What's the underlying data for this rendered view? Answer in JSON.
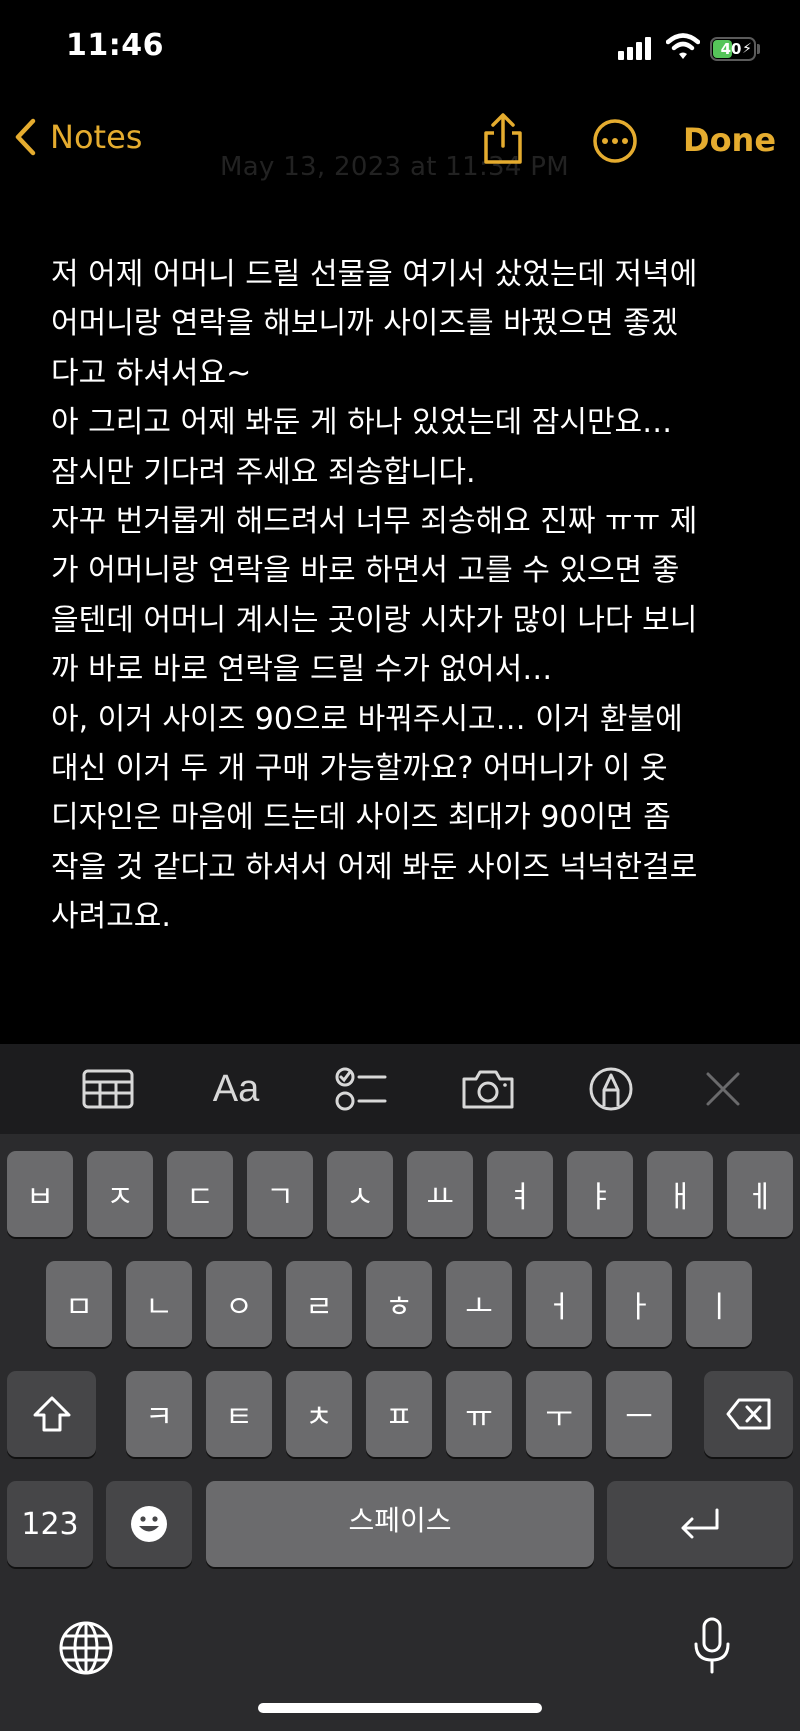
{
  "status": {
    "time": "11:46",
    "battery": "40"
  },
  "nav": {
    "back_label": "Notes",
    "done_label": "Done",
    "date_hint": "May 13, 2023 at 11:34 PM"
  },
  "note": {
    "lines": [
      "저 어제 어머니 드릴 선물을 여기서 샀었는데 저녁에",
      "어머니랑 연락을 해보니까 사이즈를 바꿨으면 좋겠",
      "다고 하셔서요~",
      "아 그리고 어제 봐둔 게 하나 있었는데 잠시만요…",
      "잠시만 기다려 주세요 죄송합니다.",
      "자꾸 번거롭게 해드려서 너무 죄송해요 진짜 ㅠㅠ 제",
      "가 어머니랑 연락을 바로 하면서 고를 수 있으면 좋",
      "을텐데 어머니 계시는 곳이랑 시차가 많이 나다 보니",
      "까 바로 바로 연락을 드릴 수가 없어서…",
      "아, 이거 사이즈 90으로 바꿔주시고… 이거 환불에",
      "대신 이거 두 개 구매 가능할까요? 어머니가 이 옷",
      "디자인은 마음에 드는데 사이즈 최대가 90이면 좀",
      "작을 것 같다고 하셔서 어제 봐둔 사이즈 넉넉한걸로",
      "사려고요."
    ]
  },
  "toolbar": {
    "format_label": "Aa"
  },
  "keyboard": {
    "row1": [
      "ㅂ",
      "ㅈ",
      "ㄷ",
      "ㄱ",
      "ㅅ",
      "ㅛ",
      "ㅕ",
      "ㅑ",
      "ㅐ",
      "ㅔ"
    ],
    "row2": [
      "ㅁ",
      "ㄴ",
      "ㅇ",
      "ㄹ",
      "ㅎ",
      "ㅗ",
      "ㅓ",
      "ㅏ",
      "ㅣ"
    ],
    "row3": [
      "ㅋ",
      "ㅌ",
      "ㅊ",
      "ㅍ",
      "ㅠ",
      "ㅜ",
      "ㅡ"
    ],
    "numbers_label": "123",
    "space_label": "스페이스"
  },
  "colors": {
    "accent": "#e5ac2f",
    "battery": "#56c55a",
    "key": "#6b6b6d",
    "key_dark": "#464648",
    "keyboard_bg": "#2b2b2d"
  },
  "icons": [
    "chevron-left-icon",
    "share-icon",
    "more-icon",
    "table-icon",
    "checklist-icon",
    "camera-icon",
    "markup-icon",
    "close-icon",
    "shift-icon",
    "delete-icon",
    "emoji-icon",
    "return-icon",
    "globe-icon",
    "microphone-icon"
  ]
}
